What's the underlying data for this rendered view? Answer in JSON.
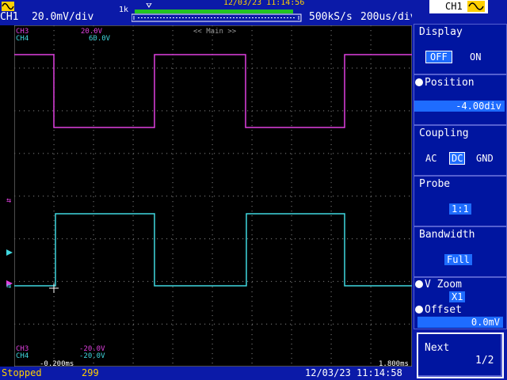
{
  "header": {
    "channel": "CH1",
    "vdiv": "20.0mV/div",
    "memory": "1k",
    "datetime_top": "12/03/23 11:14:56",
    "sample_rate": "500kS/s",
    "time_div": "200us/div"
  },
  "screen": {
    "ch3_label": "CH3",
    "ch4_label": "CH4",
    "ch3_scale_top": "20.0V",
    "ch4_scale_top": "60.0V",
    "main_label": "<< Main >>",
    "ch3_bottom_label": "CH3",
    "ch4_bottom_label": "CH4",
    "ch3_offset": "-20.0V",
    "ch4_offset": "-20.0V",
    "time_left": "-0.200ms",
    "time_right": "1.800ms",
    "colors": {
      "ch3": "#e040e0",
      "ch4": "#40d8e0",
      "grid": "#6a6a6a"
    }
  },
  "footer": {
    "status": "Stopped",
    "count": "299",
    "datetime": "12/03/23 11:14:58"
  },
  "panel": {
    "channel": "CH1",
    "display": {
      "label": "Display",
      "off": "OFF",
      "on": "ON"
    },
    "position": {
      "label": "Position",
      "value": "-4.00div"
    },
    "coupling": {
      "label": "Coupling",
      "ac": "AC",
      "dc": "DC",
      "gnd": "GND"
    },
    "probe": {
      "label": "Probe",
      "value": "1:1"
    },
    "bandwidth": {
      "label": "Bandwidth",
      "value": "Full"
    },
    "vzoom": {
      "label": "V Zoom",
      "value": "X1"
    },
    "offset": {
      "label": "Offset",
      "value": "0.0mV"
    },
    "next": {
      "label": "Next",
      "page": "1/2"
    }
  }
}
